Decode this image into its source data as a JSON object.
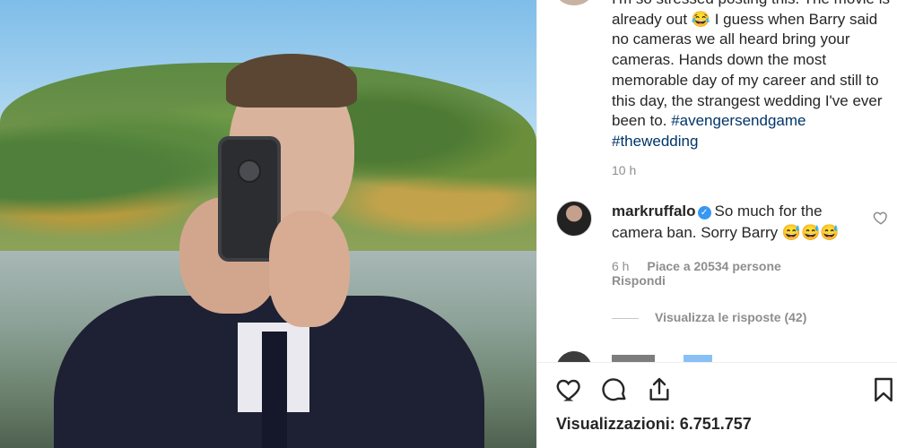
{
  "post": {
    "caption": {
      "text": "I'm so stressed posting this. The movie is already out 😂 I guess when Barry said no cameras we all heard bring your cameras. Hands down the most memorable day of my career and still to this day, the strangest wedding I've ever been to.",
      "hashtags": [
        "#avengersendgame",
        "#thewedding"
      ]
    },
    "time": "10 h"
  },
  "comment": {
    "username": "markruffalo",
    "verified_icon": "verified-badge-icon",
    "text": "So much for the camera ban. Sorry Barry 😅😅😅",
    "time": "6 h",
    "likes": "Piace a 20534 persone",
    "reply_label": "Rispondi",
    "view_replies": "Visualizza le risposte (42)",
    "like_icon": "heart-outline-icon"
  },
  "actions": {
    "icons": [
      "heart-icon",
      "comment-icon",
      "share-icon",
      "bookmark-icon"
    ],
    "views": "Visualizzazioni: 6.751.757"
  },
  "colors": {
    "text": "#262626",
    "muted": "#8e8e8e",
    "hashtag": "#003569",
    "verified": "#3897f0"
  }
}
